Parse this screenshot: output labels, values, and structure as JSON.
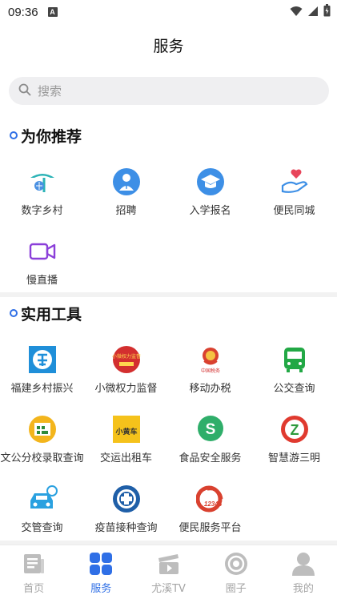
{
  "status_bar": {
    "time": "09:36",
    "notification_badge": "A"
  },
  "header": {
    "title": "服务"
  },
  "search": {
    "placeholder": "搜索"
  },
  "recommend": {
    "title": "为你推荐",
    "items": [
      {
        "label": "数字乡村",
        "icon": "digital-village-icon"
      },
      {
        "label": "招聘",
        "icon": "recruit-icon"
      },
      {
        "label": "入学报名",
        "icon": "enrollment-icon"
      },
      {
        "label": "便民同城",
        "icon": "community-heart-icon"
      },
      {
        "label": "慢直播",
        "icon": "live-video-icon"
      }
    ]
  },
  "tools": {
    "title": "实用工具",
    "items": [
      {
        "label": "福建乡村振兴",
        "icon": "rural-revitalization-icon"
      },
      {
        "label": "小微权力监督",
        "icon": "power-supervision-icon",
        "icon_text": "小微权力监督"
      },
      {
        "label": "移动办税",
        "icon": "mobile-tax-icon",
        "icon_text": "中国税务"
      },
      {
        "label": "公交查询",
        "icon": "bus-icon"
      },
      {
        "label": "文公分校录取查询",
        "icon": "school-admission-icon"
      },
      {
        "label": "交运出租车",
        "icon": "taxi-icon",
        "icon_text": "小黄车"
      },
      {
        "label": "食品安全服务",
        "icon": "food-safety-icon",
        "icon_text": "S"
      },
      {
        "label": "智慧游三明",
        "icon": "smart-tour-icon",
        "icon_text": "Z"
      },
      {
        "label": "交管查询",
        "icon": "traffic-query-icon"
      },
      {
        "label": "疫苗接种查询",
        "icon": "vaccine-query-icon"
      },
      {
        "label": "便民服务平台",
        "icon": "service-platform-icon",
        "icon_text": "12345"
      }
    ]
  },
  "tabbar": {
    "items": [
      {
        "label": "首页",
        "icon": "news-icon",
        "active": false
      },
      {
        "label": "服务",
        "icon": "grid-icon",
        "active": true
      },
      {
        "label": "尤溪TV",
        "icon": "tv-clapper-icon",
        "active": false
      },
      {
        "label": "圈子",
        "icon": "circle-icon",
        "active": false
      },
      {
        "label": "我的",
        "icon": "user-icon",
        "active": false
      }
    ]
  },
  "colors": {
    "accent": "#2f6fe6",
    "inactive": "#a5a5a5"
  }
}
